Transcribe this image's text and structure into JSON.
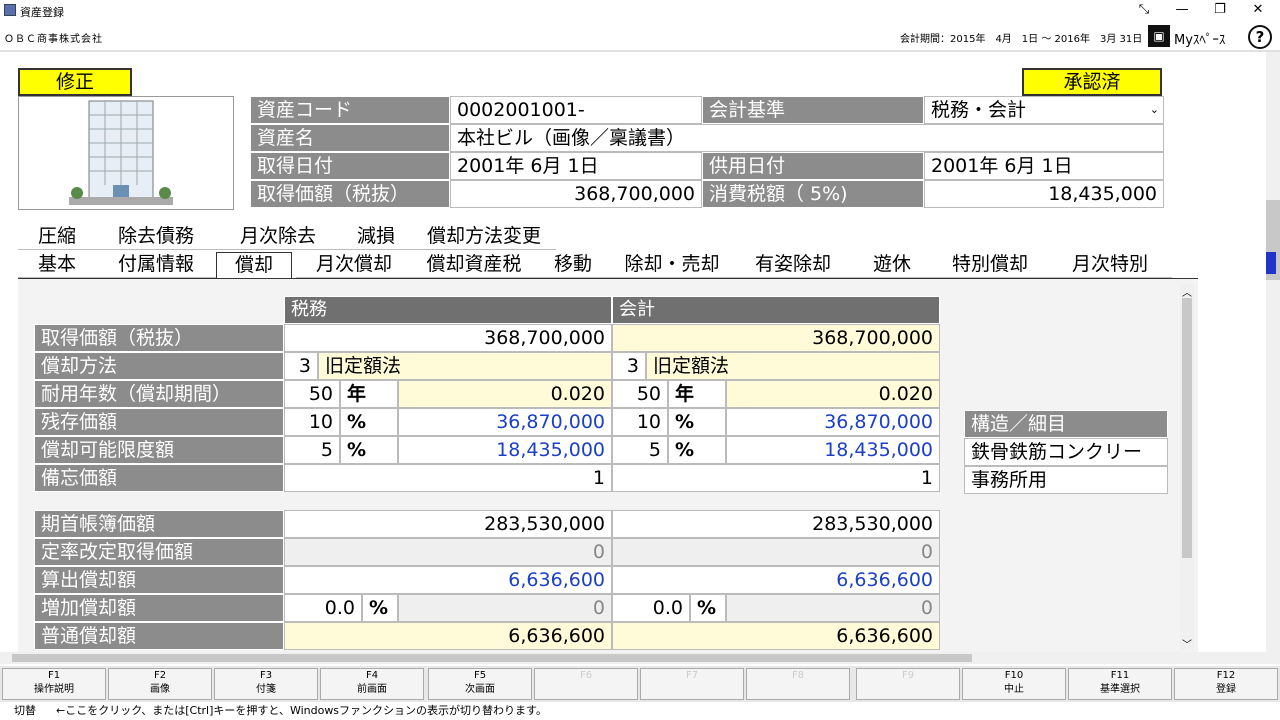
{
  "window": {
    "title": "資産登録",
    "min": "—",
    "max": "❐",
    "close": "✕"
  },
  "header": {
    "company": "ＯＢＣ商事株式会社",
    "period": "会計期間：2015年　4月　1日 ～ 2016年　3月 31日",
    "my_space": "Myｽﾍﾟｰｽ",
    "help": "?"
  },
  "status_left": "修正",
  "status_right": "承認済",
  "asset": {
    "code_label": "資産コード",
    "code": "0002001001-",
    "standard_label": "会計基準",
    "standard": "税務・会計",
    "name_label": "資産名",
    "name": "本社ビル（画像／稟議書）",
    "acq_date_label": "取得日付",
    "acq_date": "2001年 6月 1日",
    "use_date_label": "供用日付",
    "use_date": "2001年 6月 1日",
    "acq_price_label": "取得価額（税抜）",
    "acq_price": "368,700,000",
    "tax_label": "消費税額（ 5%)",
    "tax": "18,435,000"
  },
  "tabs_row1": [
    "圧縮",
    "除去債務",
    "月次除去",
    "減損",
    "償却方法変更"
  ],
  "tabs_row2": [
    "基本",
    "付属情報",
    "償却",
    "月次償却",
    "償却資産税",
    "移動",
    "除却・売却",
    "有姿除却",
    "遊休",
    "特別償却",
    "月次特別"
  ],
  "table": {
    "col_tax": "税務",
    "col_acc": "会計",
    "rows_a": {
      "acq": {
        "label": "取得価額（税抜）",
        "tax": "368,700,000",
        "acc": "368,700,000"
      },
      "method": {
        "label": "償却方法",
        "tax_no": "3",
        "tax_name": "旧定額法",
        "acc_no": "3",
        "acc_name": "旧定額法"
      },
      "life": {
        "label": "耐用年数（償却期間）",
        "tax_n": "50",
        "unit": "年",
        "tax_rate": "0.020",
        "acc_n": "50",
        "acc_rate": "0.020"
      },
      "residual": {
        "label": "残存価額",
        "tax_p": "10",
        "unit": "%",
        "tax_v": "36,870,000",
        "acc_p": "10",
        "acc_v": "36,870,000"
      },
      "limit": {
        "label": "償却可能限度額",
        "tax_p": "5",
        "unit": "%",
        "tax_v": "18,435,000",
        "acc_p": "5",
        "acc_v": "18,435,000"
      },
      "memo": {
        "label": "備忘価額",
        "tax": "1",
        "acc": "1"
      }
    },
    "rows_b": {
      "begin": {
        "label": "期首帳簿価額",
        "tax": "283,530,000",
        "acc": "283,530,000"
      },
      "fixed": {
        "label": "定率改定取得価額",
        "tax": "0",
        "acc": "0"
      },
      "calc": {
        "label": "算出償却額",
        "tax": "6,636,600",
        "acc": "6,636,600"
      },
      "add": {
        "label": "増加償却額",
        "tax_p": "0.0",
        "unit": "%",
        "tax": "0",
        "acc_p": "0.0",
        "acc": "0"
      },
      "normal": {
        "label": "普通償却額",
        "tax": "6,636,600",
        "acc": "6,636,600"
      }
    }
  },
  "structure": {
    "header": "構造／細目",
    "value1": "鉄骨鉄筋コンクリー",
    "value2": "事務所用"
  },
  "fkeys": [
    {
      "key": "F1",
      "label": "操作説明"
    },
    {
      "key": "F2",
      "label": "画像"
    },
    {
      "key": "F3",
      "label": "付箋"
    },
    {
      "key": "F4",
      "label": "前画面"
    },
    {
      "key": "F5",
      "label": "次画面"
    },
    {
      "key": "F6",
      "label": ""
    },
    {
      "key": "F7",
      "label": ""
    },
    {
      "key": "F8",
      "label": ""
    },
    {
      "key": "F9",
      "label": ""
    },
    {
      "key": "F10",
      "label": "中止"
    },
    {
      "key": "F11",
      "label": "基準選択"
    },
    {
      "key": "F12",
      "label": "登録"
    }
  ],
  "statusbar": {
    "switch": "切替",
    "message": "←ここをクリック、または[Ctrl]キーを押すと、Windowsファンクションの表示が切り替わります。"
  },
  "colors": {
    "highlight": "#ffff00",
    "label_bg": "#8c8c8c",
    "value_blue": "#1c3fc8"
  }
}
